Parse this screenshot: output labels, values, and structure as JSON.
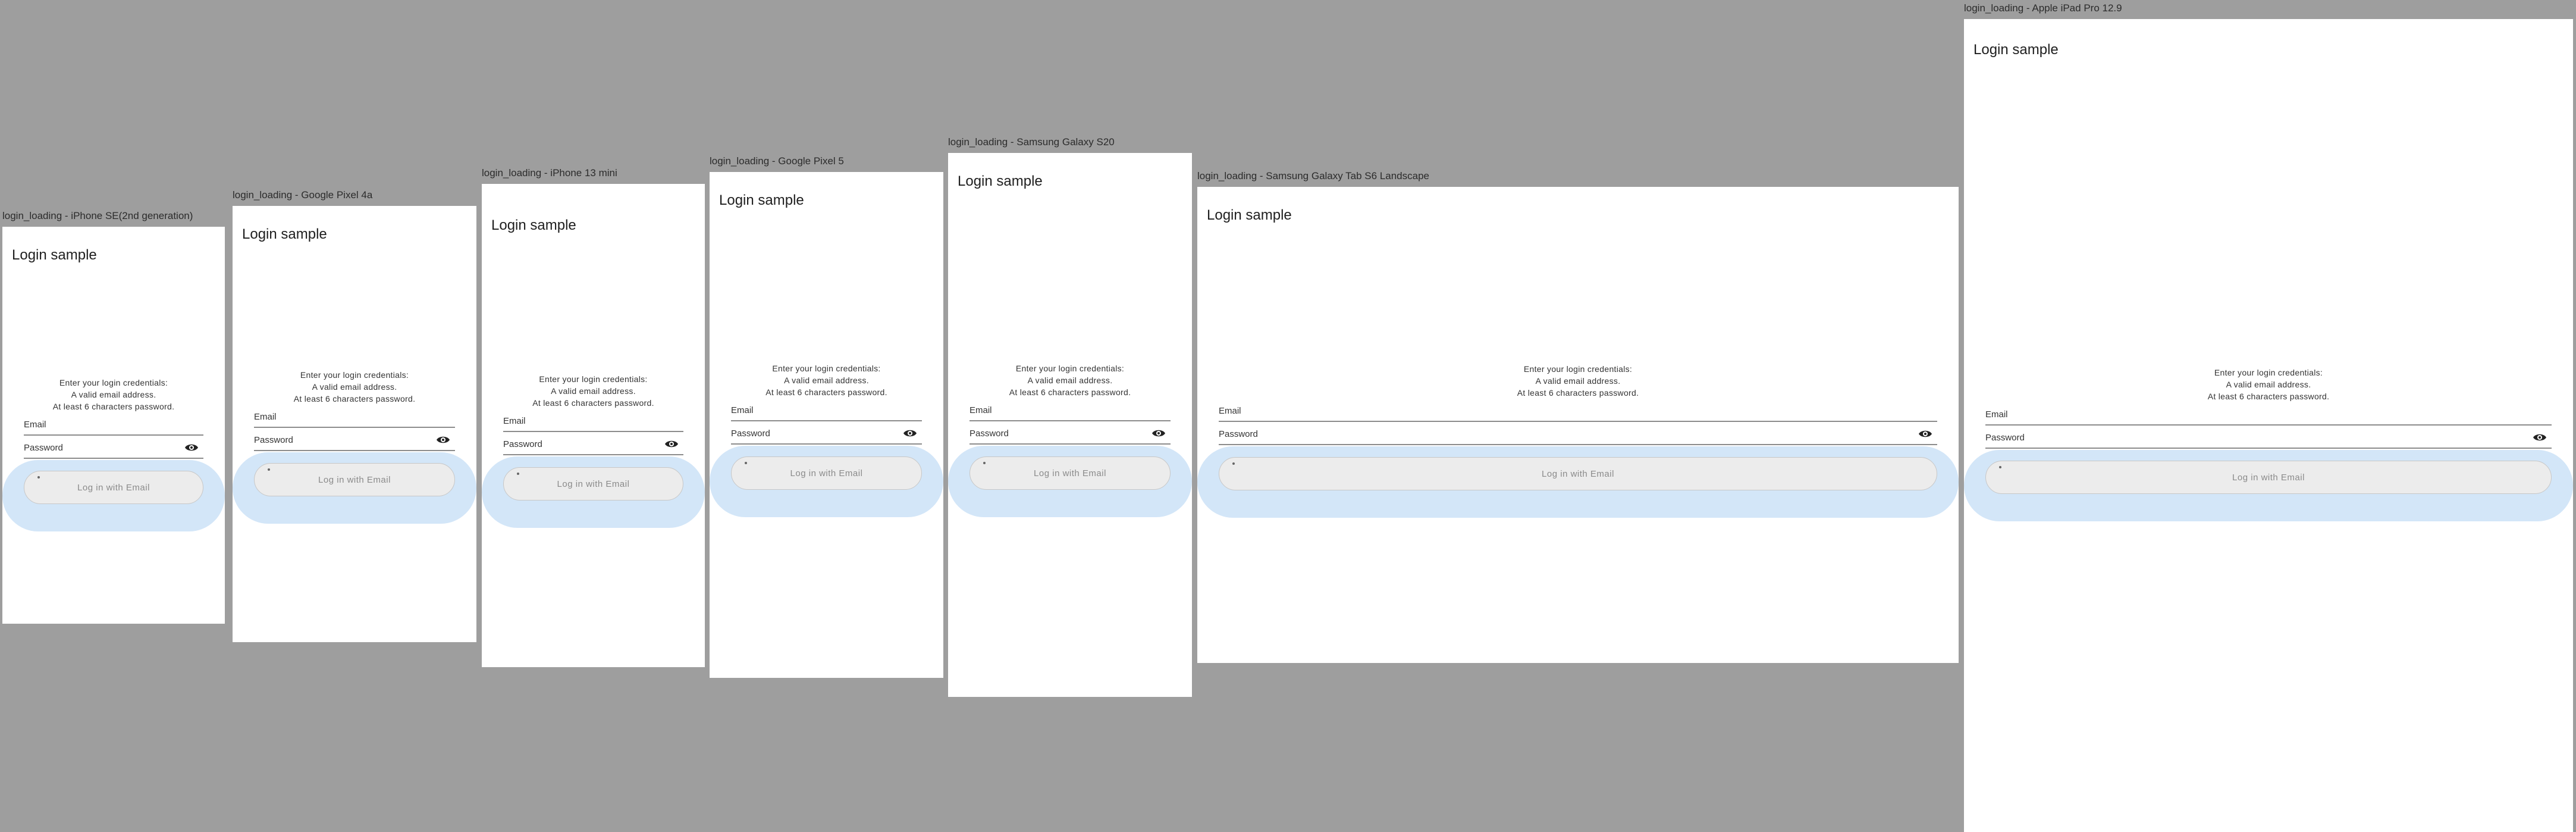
{
  "devices": [
    {
      "label": "login_loading - iPhone SE(2nd generation)"
    },
    {
      "label": "login_loading - Google Pixel 4a"
    },
    {
      "label": "login_loading - iPhone 13 mini"
    },
    {
      "label": "login_loading - Google Pixel 5"
    },
    {
      "label": "login_loading - Samsung Galaxy S20"
    },
    {
      "label": "login_loading - Samsung Galaxy Tab S6 Landscape"
    },
    {
      "label": "login_loading - Apple iPad Pro 12.9"
    }
  ],
  "app": {
    "title": "Login sample",
    "hint_line1": "Enter your login credentials:",
    "hint_line2": "A valid email address.",
    "hint_line3": "At least 6 characters password.",
    "email_label": "Email",
    "password_label": "Password",
    "login_button": "Log in with Email",
    "password_toggle_icon": "eye-icon"
  },
  "colors": {
    "backdrop": "#9e9e9e",
    "screen": "#ffffff",
    "loading_highlight": "#d3e6f8",
    "button_disabled": "#ececec"
  }
}
